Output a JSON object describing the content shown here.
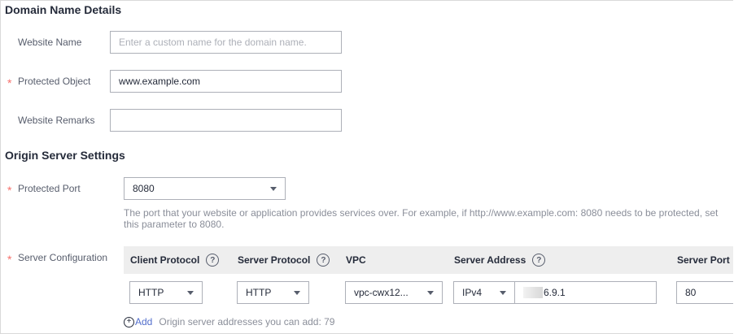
{
  "domain_section": {
    "title": "Domain Name Details",
    "website_name": {
      "label": "Website Name",
      "placeholder": "Enter a custom name for the domain name.",
      "value": ""
    },
    "protected_object": {
      "label": "Protected Object",
      "required_mark": "*",
      "value": "www.example.com"
    },
    "website_remarks": {
      "label": "Website Remarks",
      "value": ""
    }
  },
  "origin_section": {
    "title": "Origin Server Settings",
    "protected_port": {
      "label": "Protected Port",
      "required_mark": "*",
      "value": "8080",
      "hint": "The port that your website or application provides services over. For example, if http://www.example.com: 8080 needs to be protected, set this parameter to 8080."
    },
    "server_configuration": {
      "label": "Server Configuration",
      "required_mark": "*",
      "columns": {
        "client_protocol": "Client Protocol",
        "server_protocol": "Server Protocol",
        "vpc": "VPC",
        "server_address": "Server Address",
        "server_port": "Server Port"
      },
      "help_glyph": "?",
      "row": {
        "client_protocol": "HTTP",
        "server_protocol": "HTTP",
        "vpc": "vpc-cwx12...",
        "ip_version": "IPv4",
        "server_address_visible": "6.9.1",
        "server_port": "80"
      },
      "add_icon": "+",
      "add_label": "Add",
      "add_note": "Origin server addresses you can add: 79"
    }
  }
}
